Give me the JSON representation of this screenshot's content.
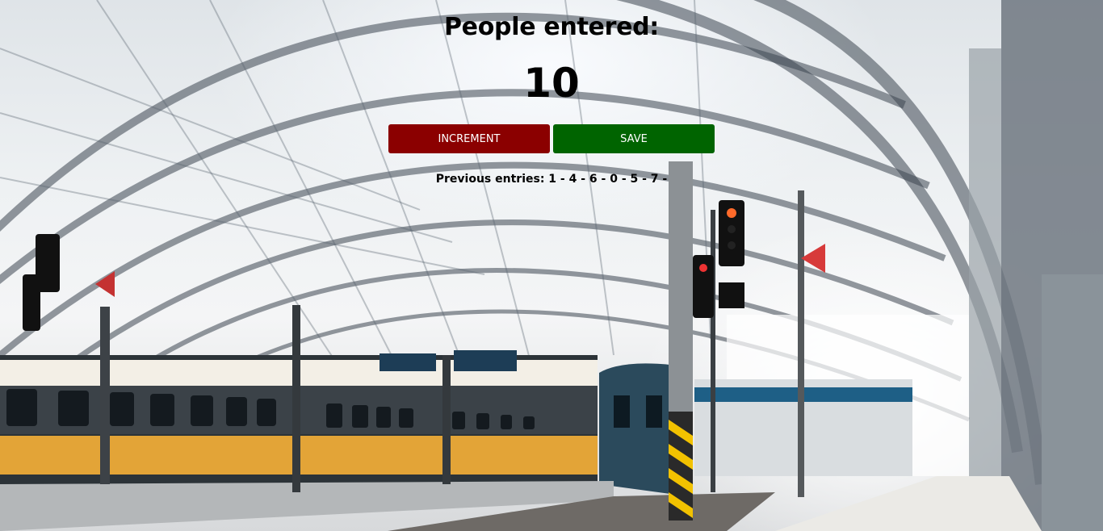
{
  "counter": {
    "title": "People entered:",
    "count": "10"
  },
  "buttons": {
    "increment_label": "INCREMENT",
    "save_label": "SAVE"
  },
  "history": {
    "text": "Previous entries: 1 - 4 - 6 - 0 - 5 - 7 -"
  },
  "colors": {
    "increment": "#8b0000",
    "save": "#006400"
  }
}
